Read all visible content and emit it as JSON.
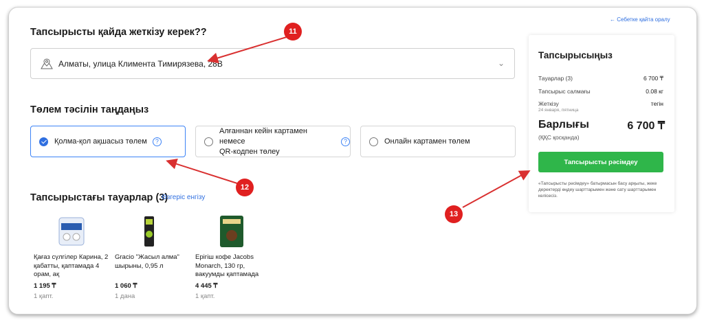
{
  "delivery": {
    "heading": "Тапсырысты қайда жеткізу керек??",
    "address": "Алматы, улица Климента Тимирязева, 28B"
  },
  "payment": {
    "heading": "Төлем тәсілін таңдаңыз",
    "options": [
      {
        "label": "Қолма-қол ақшасыз төлем",
        "selected": true,
        "has_help": true
      },
      {
        "label_line1": "Алғаннан кейін картамен немесе",
        "label_line2": "QR-кодпен төлеу",
        "selected": false,
        "has_help": true
      },
      {
        "label": "Онлайн картамен төлем",
        "selected": false,
        "has_help": false
      }
    ],
    "help_glyph": "?"
  },
  "items": {
    "heading": "Тапсырыстағы тауарлар (3)",
    "edit_link": "Өзгеріс енгізу",
    "products": [
      {
        "name": "Қағаз сүлгілер Карина, 2 қабатты, қаптамада 4 орам, ақ",
        "price": "1 195 ₸",
        "qty": "1 қапт."
      },
      {
        "name": "Gracio \"Жасыл алма\" шырыны, 0,95 л",
        "price": "1 060 ₸",
        "qty": "1 дана"
      },
      {
        "name": "Ерігіш кофе Jacobs Monarch, 130 гр, вакуумды қаптамада",
        "price": "4 445 ₸",
        "qty": "1 қапт."
      }
    ]
  },
  "back_link": "← Себетке қайта оралу",
  "summary": {
    "title": "Тапсырысыңыз",
    "goods_label": "Тауарлар (3)",
    "goods_value": "6 700 ₸",
    "weight_label": "Тапсырыс салмағы",
    "weight_value": "0.08 кг",
    "delivery_label": "Жеткізу",
    "delivery_date": "24 января, пятница",
    "delivery_value": "тегін",
    "total_label": "Барлығы",
    "total_value": "6 700 ₸",
    "vat_note": "(ҚҚС қосқанда)",
    "checkout_button": "Тапсырысты рәсімдеу",
    "legal_note": "«Тапсырысты рәсімдеу» батырмасын басу арқылы, жеке деректерді өңдеу шарттарымен және сату шарттарымен келісесіз."
  },
  "annotations": {
    "a1": "11",
    "a2": "12",
    "a3": "13"
  },
  "colors": {
    "accent": "#2f6fe0",
    "button": "#2fb64a",
    "marker": "#e02020"
  },
  "icons": {
    "address": "location-map-icon",
    "dropdown": "chevron-down-icon",
    "back": "arrow-left-icon"
  }
}
